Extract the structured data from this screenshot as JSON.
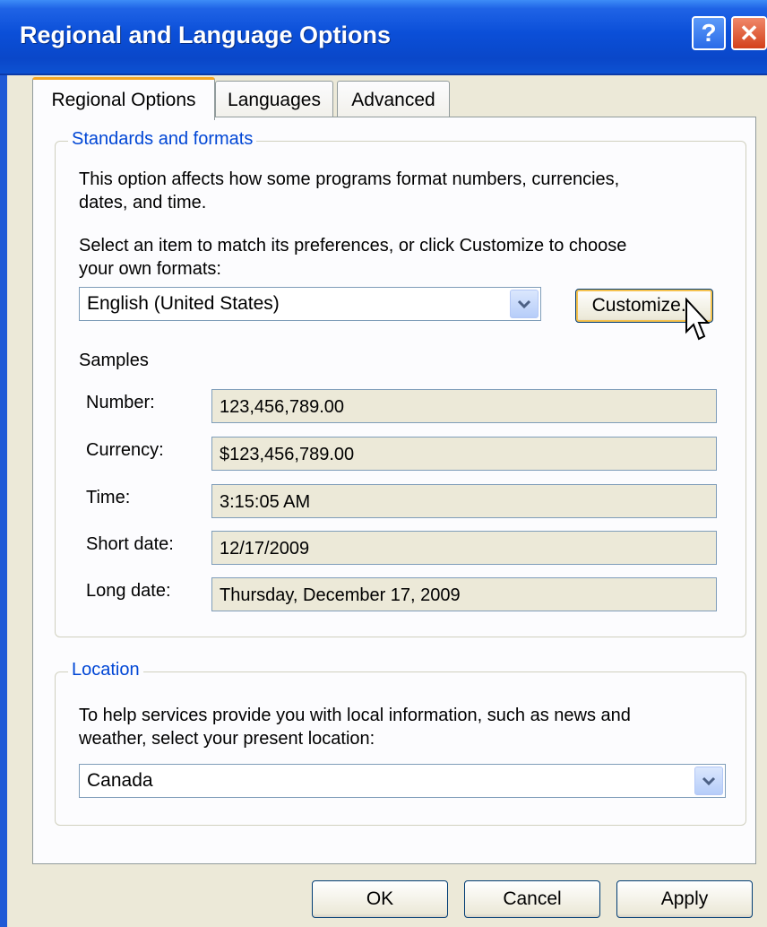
{
  "window": {
    "title": "Regional and Language Options",
    "help_glyph": "?",
    "close_glyph": "✕"
  },
  "tabs": [
    {
      "label": "Regional Options",
      "active": true
    },
    {
      "label": "Languages",
      "active": false
    },
    {
      "label": "Advanced",
      "active": false
    }
  ],
  "standards": {
    "legend": "Standards and formats",
    "description_line1": "This option affects how some programs format numbers, currencies,",
    "description_line2": "dates, and time.",
    "instruction_line1": "Select an item to match its preferences, or click Customize to choose",
    "instruction_line2": "your own formats:",
    "format_value": "English (United States)",
    "customize_label": "Customize...",
    "samples_heading": "Samples",
    "samples": [
      {
        "label": "Number:",
        "value": "123,456,789.00"
      },
      {
        "label": "Currency:",
        "value": "$123,456,789.00"
      },
      {
        "label": "Time:",
        "value": "3:15:05 AM"
      },
      {
        "label": "Short date:",
        "value": "12/17/2009"
      },
      {
        "label": "Long date:",
        "value": "Thursday, December 17, 2009"
      }
    ]
  },
  "location": {
    "legend": "Location",
    "description_line1": "To help services provide you with local information, such as news and",
    "description_line2": "weather, select your present location:",
    "value": "Canada"
  },
  "footer": {
    "ok_label": "OK",
    "cancel_label": "Cancel",
    "apply_label": "Apply"
  },
  "colors": {
    "titlebar": "#0b4fd8",
    "legend_text": "#0046d5",
    "active_tab_accent": "#f5a623",
    "dialog_bg": "#ece9d8"
  }
}
